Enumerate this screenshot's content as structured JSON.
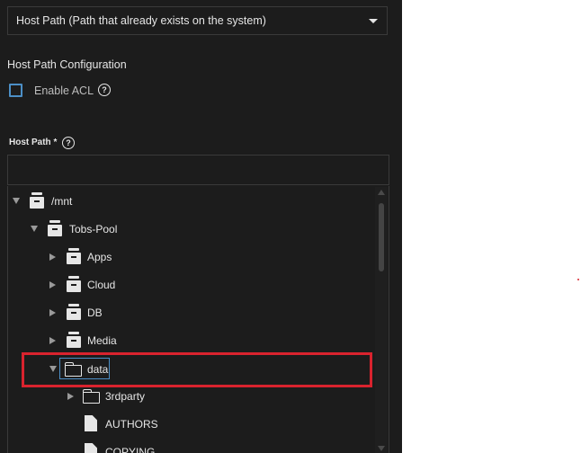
{
  "dropdown": {
    "value": "Host Path (Path that already exists on the system)"
  },
  "config": {
    "title": "Host Path Configuration",
    "enable_acl_label": "Enable ACL",
    "acl_checked": false
  },
  "host_path": {
    "label": "Host Path *",
    "value": ""
  },
  "tree": {
    "nodes": [
      {
        "label": "/mnt",
        "icon": "dataset-icon",
        "expanded": true
      },
      {
        "label": "Tobs-Pool",
        "icon": "dataset-icon",
        "expanded": true
      },
      {
        "label": "Apps",
        "icon": "dataset-icon",
        "expanded": false
      },
      {
        "label": "Cloud",
        "icon": "dataset-icon",
        "expanded": false
      },
      {
        "label": "DB",
        "icon": "dataset-icon",
        "expanded": false
      },
      {
        "label": "Media",
        "icon": "dataset-icon",
        "expanded": false
      },
      {
        "label": "data",
        "icon": "folder-icon",
        "expanded": true,
        "selected": true
      },
      {
        "label": "3rdparty",
        "icon": "folder-icon",
        "expanded": false
      },
      {
        "label": "AUTHORS",
        "icon": "file-icon"
      },
      {
        "label": "COPYING",
        "icon": "file-icon"
      }
    ]
  },
  "colors": {
    "highlight": "#d9232e",
    "accent": "#4c8fc6",
    "panel": "#1c1c1c"
  }
}
